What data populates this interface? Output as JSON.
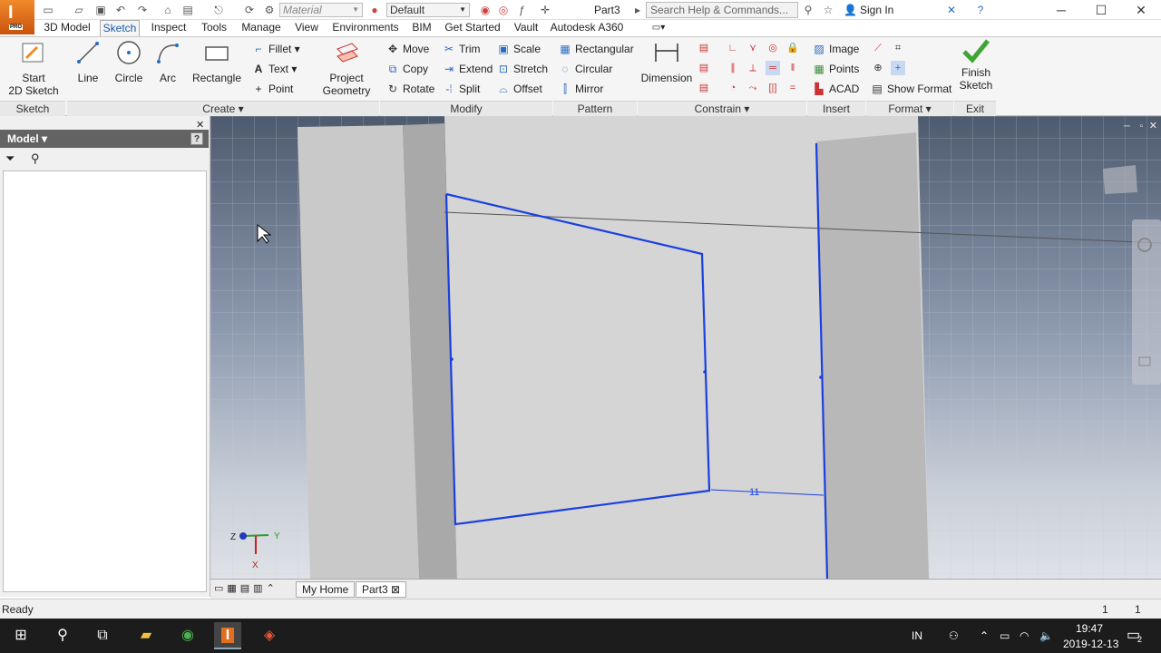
{
  "app": {
    "logo_letter": "I",
    "logo_badge": "PRO",
    "document_title": "Part3"
  },
  "quick_access": {
    "material_placeholder": "Material",
    "appearance_value": "Default",
    "search_placeholder": "Search Help & Commands...",
    "signin_label": "Sign In"
  },
  "tabs": [
    "3D Model",
    "Sketch",
    "Inspect",
    "Tools",
    "Manage",
    "View",
    "Environments",
    "BIM",
    "Get Started",
    "Vault",
    "Autodesk A360"
  ],
  "active_tab": "Sketch",
  "ribbon": {
    "sketch": {
      "start_label_1": "Start",
      "start_label_2": "2D Sketch",
      "group_label": "Sketch"
    },
    "create": {
      "line": "Line",
      "circle": "Circle",
      "arc": "Arc",
      "rectangle": "Rectangle",
      "fillet": "Fillet",
      "text": "Text",
      "point": "Point",
      "project_1": "Project",
      "project_2": "Geometry",
      "group_label": "Create"
    },
    "modify": {
      "move": "Move",
      "copy": "Copy",
      "rotate": "Rotate",
      "trim": "Trim",
      "extend": "Extend",
      "split": "Split",
      "scale": "Scale",
      "stretch": "Stretch",
      "offset": "Offset",
      "group_label": "Modify"
    },
    "pattern": {
      "rectangular": "Rectangular",
      "circular": "Circular",
      "mirror": "Mirror",
      "group_label": "Pattern"
    },
    "constrain": {
      "dimension": "Dimension",
      "group_label": "Constrain"
    },
    "insert": {
      "image": "Image",
      "points": "Points",
      "acad": "ACAD",
      "group_label": "Insert"
    },
    "format": {
      "show_format": "Show Format",
      "group_label": "Format"
    },
    "exit": {
      "finish_1": "Finish",
      "finish_2": "Sketch",
      "group_label": "Exit"
    }
  },
  "browser": {
    "title": "Model",
    "help": "?"
  },
  "viewport": {
    "dimension_value": "11",
    "triad": {
      "z": "Z",
      "y": "Y",
      "x": "X"
    }
  },
  "doc_tabs": {
    "home": "My Home",
    "part": "Part3"
  },
  "status": {
    "text": "Ready",
    "count_a": "1",
    "count_b": "1"
  },
  "taskbar": {
    "lang": "IN",
    "time": "19:47",
    "date": "2019-12-13",
    "notif_count": "2"
  },
  "colors": {
    "sketch_line": "#1a3fe0",
    "accent": "#1a5aa8",
    "finish_check": "#3fa535"
  }
}
